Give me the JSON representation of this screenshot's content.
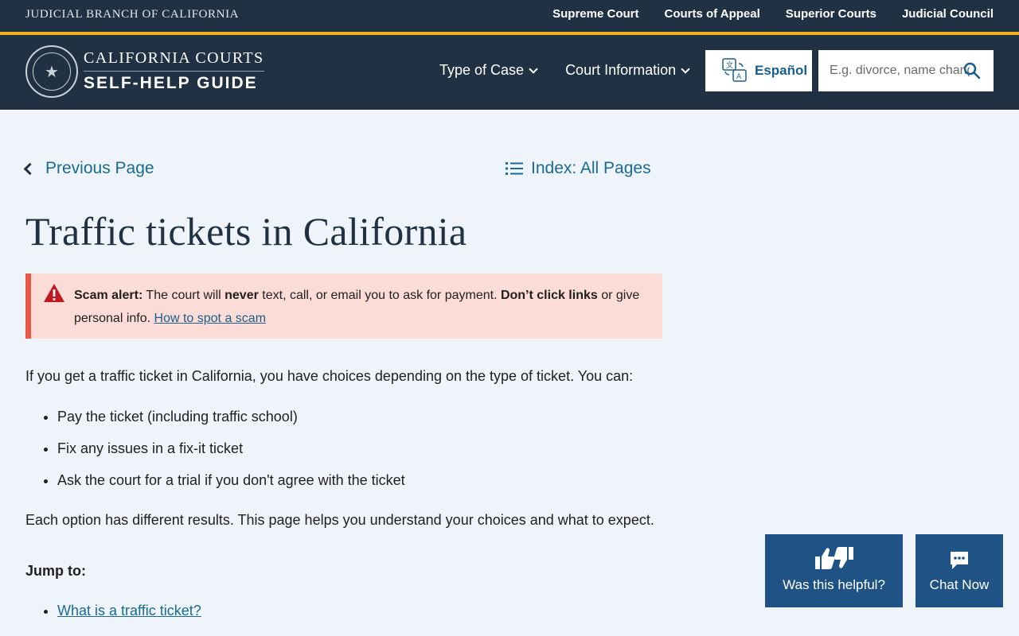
{
  "utility_bar": {
    "branch_name": "JUDICIAL BRANCH OF CALIFORNIA",
    "links": [
      "Supreme Court",
      "Courts of Appeal",
      "Superior Courts",
      "Judicial Council"
    ]
  },
  "header": {
    "brand_line1": "CALIFORNIA COURTS",
    "brand_line2": "SELF-HELP GUIDE",
    "nav": [
      {
        "label": "Type of Case"
      },
      {
        "label": "Court Information"
      }
    ],
    "language_button": "Español",
    "search": {
      "placeholder": "E.g. divorce, name change, ...",
      "value": ""
    }
  },
  "breadcrumbs": {
    "previous": "Previous Page",
    "index": "Index: All Pages"
  },
  "page_title": "Traffic tickets in California",
  "alert": {
    "label": "Scam alert:",
    "text1": " The court will ",
    "never": "never",
    "text2": " text, call, or email you to ask for payment. ",
    "dont_click": "Don’t click links",
    "text3": " or give personal info. ",
    "link": "How to spot a scam",
    "accent_color": "#e85a48",
    "background_color": "#fbdcd7"
  },
  "content": {
    "intro": "If you get a traffic ticket in California, you have choices depending on the type of ticket. You can:",
    "choices": [
      "Pay the ticket (including traffic school)",
      "Fix any issues in a fix-it ticket",
      "Ask the court for a trial if you don't agree with the ticket"
    ],
    "outro": "Each option has different results. This page helps you understand your choices and what to expect.",
    "jump_label": "Jump to:",
    "jump_links": [
      "What is a traffic ticket?"
    ]
  },
  "floating": {
    "helpful_label": "Was this helpful?",
    "chat_label": "Chat Now"
  },
  "colors": {
    "navy": "#1f3143",
    "gold": "#f2b21d",
    "link": "#1a6a93",
    "float_button": "#1f5285",
    "page_bg": "#eef4f9"
  }
}
